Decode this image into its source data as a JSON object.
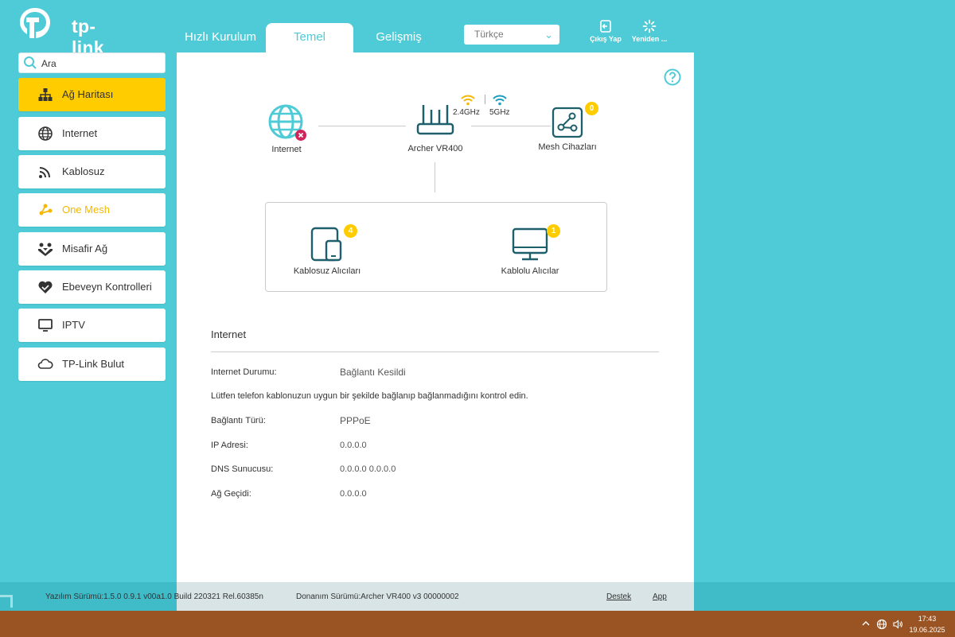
{
  "brand": {
    "logo_text": "tp-link",
    "accent": "#4ecbd6",
    "highlight": "#ffcc00"
  },
  "tabs": [
    {
      "label": "Hızlı Kurulum"
    },
    {
      "label": "Temel",
      "active": true
    },
    {
      "label": "Gelişmiş"
    }
  ],
  "language": {
    "selected": "Türkçe"
  },
  "header_buttons": {
    "logout": "Çıkış Yap",
    "reboot": "Yeniden ..."
  },
  "search": {
    "placeholder": "Ara"
  },
  "sidebar": {
    "items": [
      {
        "label": "Ağ Haritası",
        "icon": "network-map-icon",
        "active": true
      },
      {
        "label": "Internet",
        "icon": "globe-icon"
      },
      {
        "label": "Kablosuz",
        "icon": "wifi-icon"
      },
      {
        "label": "One Mesh",
        "icon": "mesh-icon"
      },
      {
        "label": "Misafir Ağ",
        "icon": "guest-icon"
      },
      {
        "label": "Ebeveyn Kontrolleri",
        "icon": "parental-heart-icon"
      },
      {
        "label": "IPTV",
        "icon": "tv-icon"
      },
      {
        "label": "TP-Link Bulut",
        "icon": "cloud-icon"
      }
    ]
  },
  "map": {
    "internet_label": "Internet",
    "router_label": "Archer VR400",
    "band_24": "2.4GHz",
    "band_5": "5GHz",
    "mesh_label": "Mesh Cihazları",
    "mesh_count": "0",
    "wireless_label": "Kablosuz Alıcıları",
    "wireless_count": "4",
    "wired_label": "Kablolu Alıcılar",
    "wired_count": "1"
  },
  "internet_info": {
    "title": "Internet",
    "status_label": "Internet Durumu:",
    "status_value": "Bağlantı Kesildi",
    "warning": "Lütfen telefon kablonuzun uygun bir şekilde bağlanıp bağlanmadığını kontrol edin.",
    "conn_type_label": "Bağlantı Türü:",
    "conn_type_value": "PPPoE",
    "ip_label": "IP Adresi:",
    "ip_value": "0.0.0.0",
    "dns_label": "DNS Sunucusu:",
    "dns_value": "0.0.0.0 0.0.0.0",
    "gateway_label": "Ağ Geçidi:",
    "gateway_value": "0.0.0.0"
  },
  "footer": {
    "firmware": "Yazılım Sürümü:1.5.0 0.9.1 v00a1.0 Build 220321 Rel.60385n",
    "hardware": "Donanım Sürümü:Archer VR400 v3 00000002",
    "support_link": "Destek",
    "app_link": "App"
  },
  "taskbar": {
    "time": "17:43",
    "date": "19.06.2025"
  }
}
